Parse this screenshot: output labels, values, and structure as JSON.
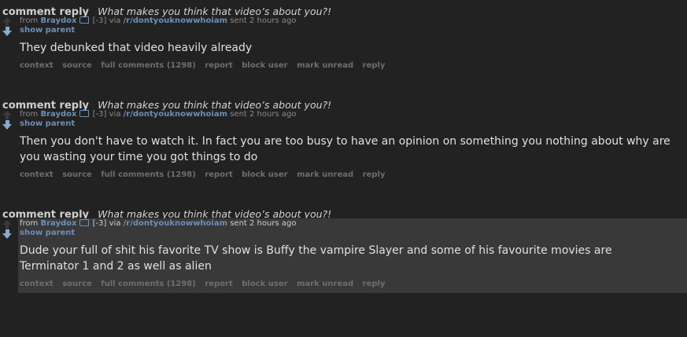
{
  "messages": [
    {
      "subject_type": "comment reply",
      "subject_link": "What makes you think that video’s about you?!",
      "from_label": "from",
      "author": "Braydox",
      "score": "[-3]",
      "via_label": "via",
      "subreddit": "/r/dontyouknowwhoiam",
      "sent_label": "sent 2 hours ago",
      "show_parent": "show parent",
      "body": "They debunked that video heavily already",
      "actions": [
        "context",
        "source",
        "full comments (1298)",
        "report",
        "block user",
        "mark unread",
        "reply"
      ]
    },
    {
      "subject_type": "comment reply",
      "subject_link": "What makes you think that video’s about you?!",
      "from_label": "from",
      "author": "Braydox",
      "score": "[-3]",
      "via_label": "via",
      "subreddit": "/r/dontyouknowwhoiam",
      "sent_label": "sent 2 hours ago",
      "show_parent": "show parent",
      "body": "Then you don't have to watch it. In fact you are too busy to have an opinion on something you nothing about why are you wasting your time you got things to do",
      "actions": [
        "context",
        "source",
        "full comments (1298)",
        "report",
        "block user",
        "mark unread",
        "reply"
      ]
    },
    {
      "subject_type": "comment reply",
      "subject_link": "What makes you think that video’s about you?!",
      "from_label": "from",
      "author": "Braydox",
      "score": "[-3]",
      "via_label": "via",
      "subreddit": "/r/dontyouknowwhoiam",
      "sent_label": "sent 2 hours ago",
      "show_parent": "show parent",
      "body": "Dude your full of shit his favorite TV show is Buffy the vampire Slayer and some of his favourite movies are Terminator 1 and 2 as well as alien",
      "actions": [
        "context",
        "source",
        "full comments (1298)",
        "report",
        "block user",
        "mark unread",
        "reply"
      ]
    }
  ]
}
